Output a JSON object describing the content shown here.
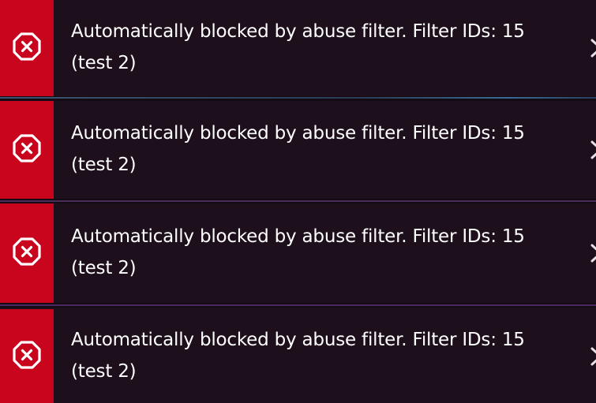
{
  "notifications": [
    {
      "message": "Automatically blocked by abuse filter. Filter IDs: 15 (test 2)",
      "icon": "error-circle-x-icon",
      "action_icon": "close-icon"
    },
    {
      "message": "Automatically blocked by abuse filter. Filter IDs: 15 (test 2)",
      "icon": "error-circle-x-icon",
      "action_icon": "close-icon"
    },
    {
      "message": "Automatically blocked by abuse filter. Filter IDs: 15 (test 2)",
      "icon": "error-circle-x-icon",
      "action_icon": "close-icon"
    },
    {
      "message": "Automatically blocked by abuse filter. Filter IDs: 15 (test 2)",
      "icon": "error-circle-x-icon",
      "action_icon": "close-icon"
    }
  ],
  "colors": {
    "error_stripe": "#c8051d",
    "toast_background": "#1d0f1c",
    "text": "#ffffff",
    "divider_blue": "#3a5a7a",
    "divider_purple": "#4a2a5a"
  }
}
